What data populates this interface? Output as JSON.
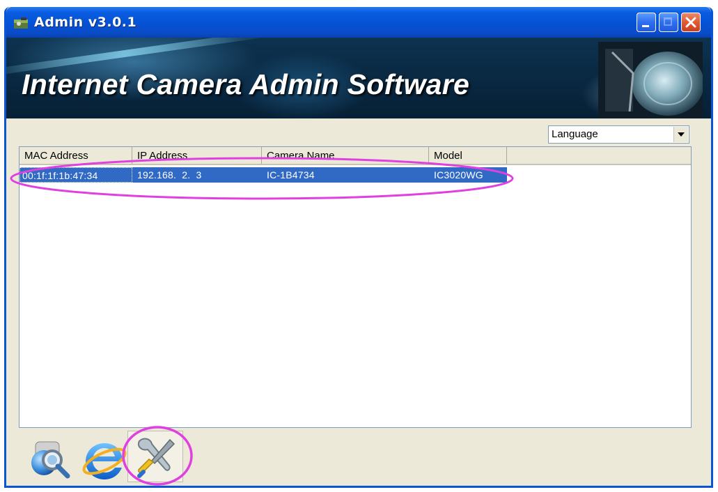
{
  "window": {
    "title": "Admin v3.0.1"
  },
  "banner": {
    "title": "Internet Camera Admin Software"
  },
  "language_select": {
    "selected": "Language"
  },
  "camera_list": {
    "columns": [
      "MAC Address",
      "IP Address",
      "Camera Name",
      "Model"
    ],
    "rows": [
      {
        "mac": "00:1f:1f:1b:47:34",
        "ip": "192.168.  2.  3",
        "name": "IC-1B4734",
        "model": "IC3020WG"
      }
    ]
  },
  "toolbar": {
    "icons": [
      "search-icon",
      "internet-explorer-icon",
      "tools-icon"
    ]
  },
  "annotation_color": "#e040e0"
}
